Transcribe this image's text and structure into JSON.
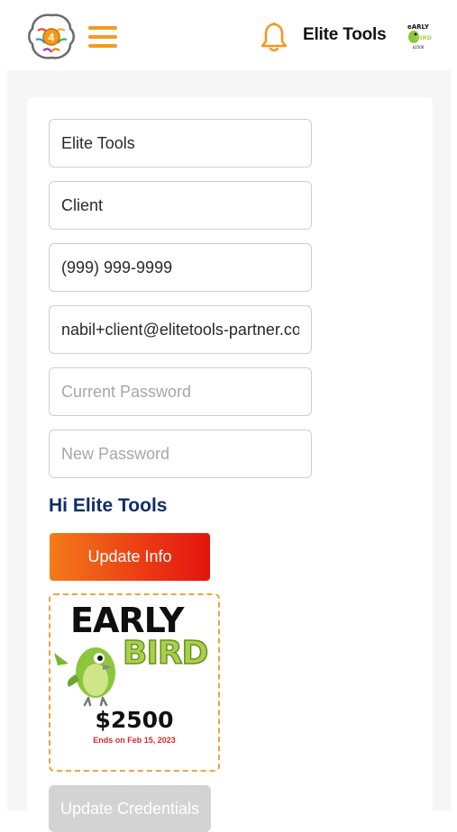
{
  "header": {
    "brand_name": "Elite Tools",
    "logo_icon": "brain-gear-logo-icon",
    "menu_icon": "hamburger-menu-icon",
    "notification_icon": "bell-icon",
    "avatar_icon": "early-bird-avatar-icon",
    "accent_color": "#f39a1e"
  },
  "form": {
    "first_name_value": "Elite Tools",
    "last_name_value": "Client",
    "phone_value": "(999) 999-9999",
    "email_value": "nabil+client@elitetools-partner.com",
    "current_password_placeholder": "Current Password",
    "new_password_placeholder": "New Password",
    "greeting": "Hi Elite Tools",
    "update_info_label": "Update Info",
    "update_credentials_label": "Update Credentials"
  },
  "promo": {
    "line1": "EARLY",
    "line2": "BIRD",
    "price": "$2500",
    "ends": "Ends on Feb 15, 2023",
    "icon": "green-bird-mascot-icon"
  },
  "colors": {
    "greeting_text": "#0d2e67",
    "button_gradient_start": "#f47b1a",
    "button_gradient_end": "#e3140e",
    "promo_border": "#f0a33a",
    "disabled_button": "#d3d3d3"
  }
}
